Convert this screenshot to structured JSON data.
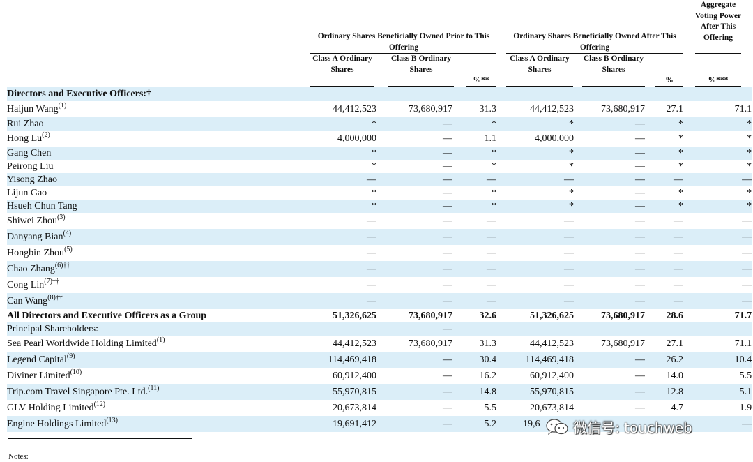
{
  "header": {
    "prior_group": "Ordinary Shares Beneficially Owned Prior to This Offering",
    "after_group": "Ordinary Shares Beneficially Owned After This Offering",
    "voting_group": "Aggregate Voting Power After This Offering",
    "cols": [
      "Class A Ordinary Shares",
      "Class B Ordinary Shares",
      "%**",
      "Class A Ordinary Shares",
      "Class B Ordinary Shares",
      "%",
      "%***"
    ]
  },
  "section_directors": "Directors and Executive Officers:†",
  "rows": [
    {
      "name": "Haijun Wang",
      "sup": "(1)",
      "c1": "44,412,523",
      "c2": "73,680,917",
      "c3": "31.3",
      "c4": "44,412,523",
      "c5": "73,680,917",
      "c6": "27.1",
      "c7": "71.1"
    },
    {
      "name": "Rui Zhao",
      "sup": "",
      "c1": "*",
      "c2": "—",
      "c3": "*",
      "c4": "*",
      "c5": "—",
      "c6": "*",
      "c7": "*"
    },
    {
      "name": "Hong Lu",
      "sup": "(2)",
      "c1": "4,000,000",
      "c2": "—",
      "c3": "1.1",
      "c4": "4,000,000",
      "c5": "—",
      "c6": "*",
      "c7": "*"
    },
    {
      "name": "Gang Chen",
      "sup": "",
      "c1": "*",
      "c2": "—",
      "c3": "*",
      "c4": "*",
      "c5": "—",
      "c6": "*",
      "c7": "*"
    },
    {
      "name": "Peirong Liu",
      "sup": "",
      "c1": "*",
      "c2": "—",
      "c3": "*",
      "c4": "*",
      "c5": "—",
      "c6": "*",
      "c7": "*"
    },
    {
      "name": "Yisong Zhao",
      "sup": "",
      "c1": "—",
      "c2": "—",
      "c3": "—",
      "c4": "—",
      "c5": "—",
      "c6": "—",
      "c7": "—"
    },
    {
      "name": "Lijun Gao",
      "sup": "",
      "c1": "*",
      "c2": "—",
      "c3": "*",
      "c4": "*",
      "c5": "—",
      "c6": "*",
      "c7": "*"
    },
    {
      "name": "Hsueh Chun Tang",
      "sup": "",
      "c1": "*",
      "c2": "—",
      "c3": "*",
      "c4": "*",
      "c5": "—",
      "c6": "*",
      "c7": "*"
    },
    {
      "name": "Shiwei Zhou",
      "sup": "(3)",
      "c1": "—",
      "c2": "—",
      "c3": "—",
      "c4": "—",
      "c5": "—",
      "c6": "—",
      "c7": "—"
    },
    {
      "name": "Danyang Bian",
      "sup": "(4)",
      "c1": "—",
      "c2": "—",
      "c3": "—",
      "c4": "—",
      "c5": "—",
      "c6": "—",
      "c7": "—"
    },
    {
      "name": "Hongbin Zhou",
      "sup": "(5)",
      "c1": "—",
      "c2": "—",
      "c3": "—",
      "c4": "—",
      "c5": "—",
      "c6": "—",
      "c7": "—"
    },
    {
      "name": "Chao Zhang",
      "sup": "(6)††",
      "c1": "—",
      "c2": "—",
      "c3": "—",
      "c4": "—",
      "c5": "—",
      "c6": "—",
      "c7": "—"
    },
    {
      "name": "Cong Lin",
      "sup": "(7)††",
      "c1": "—",
      "c2": "—",
      "c3": "—",
      "c4": "—",
      "c5": "—",
      "c6": "—",
      "c7": "—"
    },
    {
      "name": "Can Wang",
      "sup": "(8)††",
      "c1": "—",
      "c2": "—",
      "c3": "—",
      "c4": "—",
      "c5": "—",
      "c6": "—",
      "c7": "—"
    }
  ],
  "group_total": {
    "name": "All Directors and Executive Officers as a Group",
    "c1": "51,326,625",
    "c2": "73,680,917",
    "c3": "32.6",
    "c4": "51,326,625",
    "c5": "73,680,917",
    "c6": "28.6",
    "c7": "71.7"
  },
  "section_principal": "Principal Shareholders:",
  "section_principal_c2": "—",
  "principal_rows": [
    {
      "name": "Sea Pearl Worldwide Holding Limited",
      "sup": "(1)",
      "c1": "44,412,523",
      "c2": "73,680,917",
      "c3": "31.3",
      "c4": "44,412,523",
      "c5": "73,680,917",
      "c6": "27.1",
      "c7": "71.1"
    },
    {
      "name": "Legend Capital",
      "sup": "(9)",
      "c1": "114,469,418",
      "c2": "—",
      "c3": "30.4",
      "c4": "114,469,418",
      "c5": "—",
      "c6": "26.2",
      "c7": "10.4"
    },
    {
      "name": "Diviner Limited",
      "sup": "(10)",
      "c1": "60,912,400",
      "c2": "—",
      "c3": "16.2",
      "c4": "60,912,400",
      "c5": "—",
      "c6": "14.0",
      "c7": "5.5"
    },
    {
      "name": "Trip.com Travel Singapore Pte. Ltd.",
      "sup": "(11)",
      "c1": "55,970,815",
      "c2": "—",
      "c3": "14.8",
      "c4": "55,970,815",
      "c5": "—",
      "c6": "12.8",
      "c7": "5.1"
    },
    {
      "name": "GLV Holding Limited",
      "sup": "(12)",
      "c1": "20,673,814",
      "c2": "—",
      "c3": "5.5",
      "c4": "20,673,814",
      "c5": "—",
      "c6": "4.7",
      "c7": "1.9"
    },
    {
      "name": "Engine Holdings Limited",
      "sup": "(13)",
      "c1": "19,691,412",
      "c2": "—",
      "c3": "5.2",
      "c4": "19,6",
      "c5": "",
      "c6": "",
      "c7": "—"
    }
  ],
  "notes_label": "Notes:",
  "watermark": "微信号: touchweb"
}
